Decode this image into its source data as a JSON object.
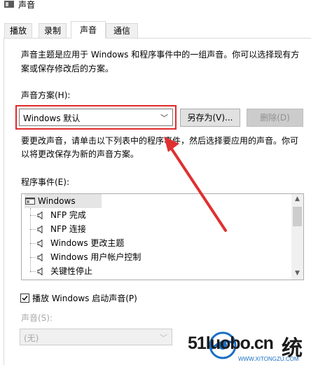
{
  "window": {
    "title": "声音"
  },
  "tabs": [
    {
      "label": "播放",
      "active": false
    },
    {
      "label": "录制",
      "active": false
    },
    {
      "label": "声音",
      "active": true
    },
    {
      "label": "通信",
      "active": false
    }
  ],
  "description": {
    "line1": "声音主题是应用于 Windows 和程序事件中的一组声音。你可以选择现有方",
    "line2": "案或保存修改后的方案。"
  },
  "scheme": {
    "label": "声音方案(H):",
    "selected": "Windows 默认",
    "save_as_label": "另存为(V)...",
    "delete_label": "删除(D)"
  },
  "instruction": {
    "line1": "要更改声音，请单击以下列表中的程序事件，然后选择要应用的声音。你可",
    "line2": "以将更改保存为新的声音方案。"
  },
  "events": {
    "label": "程序事件(E):",
    "root": "Windows",
    "items": [
      "NFP 完成",
      "NFP 连接",
      "Windows 更改主题",
      "Windows 用户帐户控制",
      "关键性停止"
    ]
  },
  "startup": {
    "label": "播放 Windows 启动声音(P)",
    "checked": true
  },
  "sound": {
    "label": "声音(S):",
    "selected": "(无)"
  },
  "watermark": {
    "brand": "51luobo.cn",
    "suffix": "统",
    "site": "WWW.XITONGZU.COM"
  },
  "colors": {
    "highlight": "#e02a2a",
    "arrow": "#e03030"
  }
}
